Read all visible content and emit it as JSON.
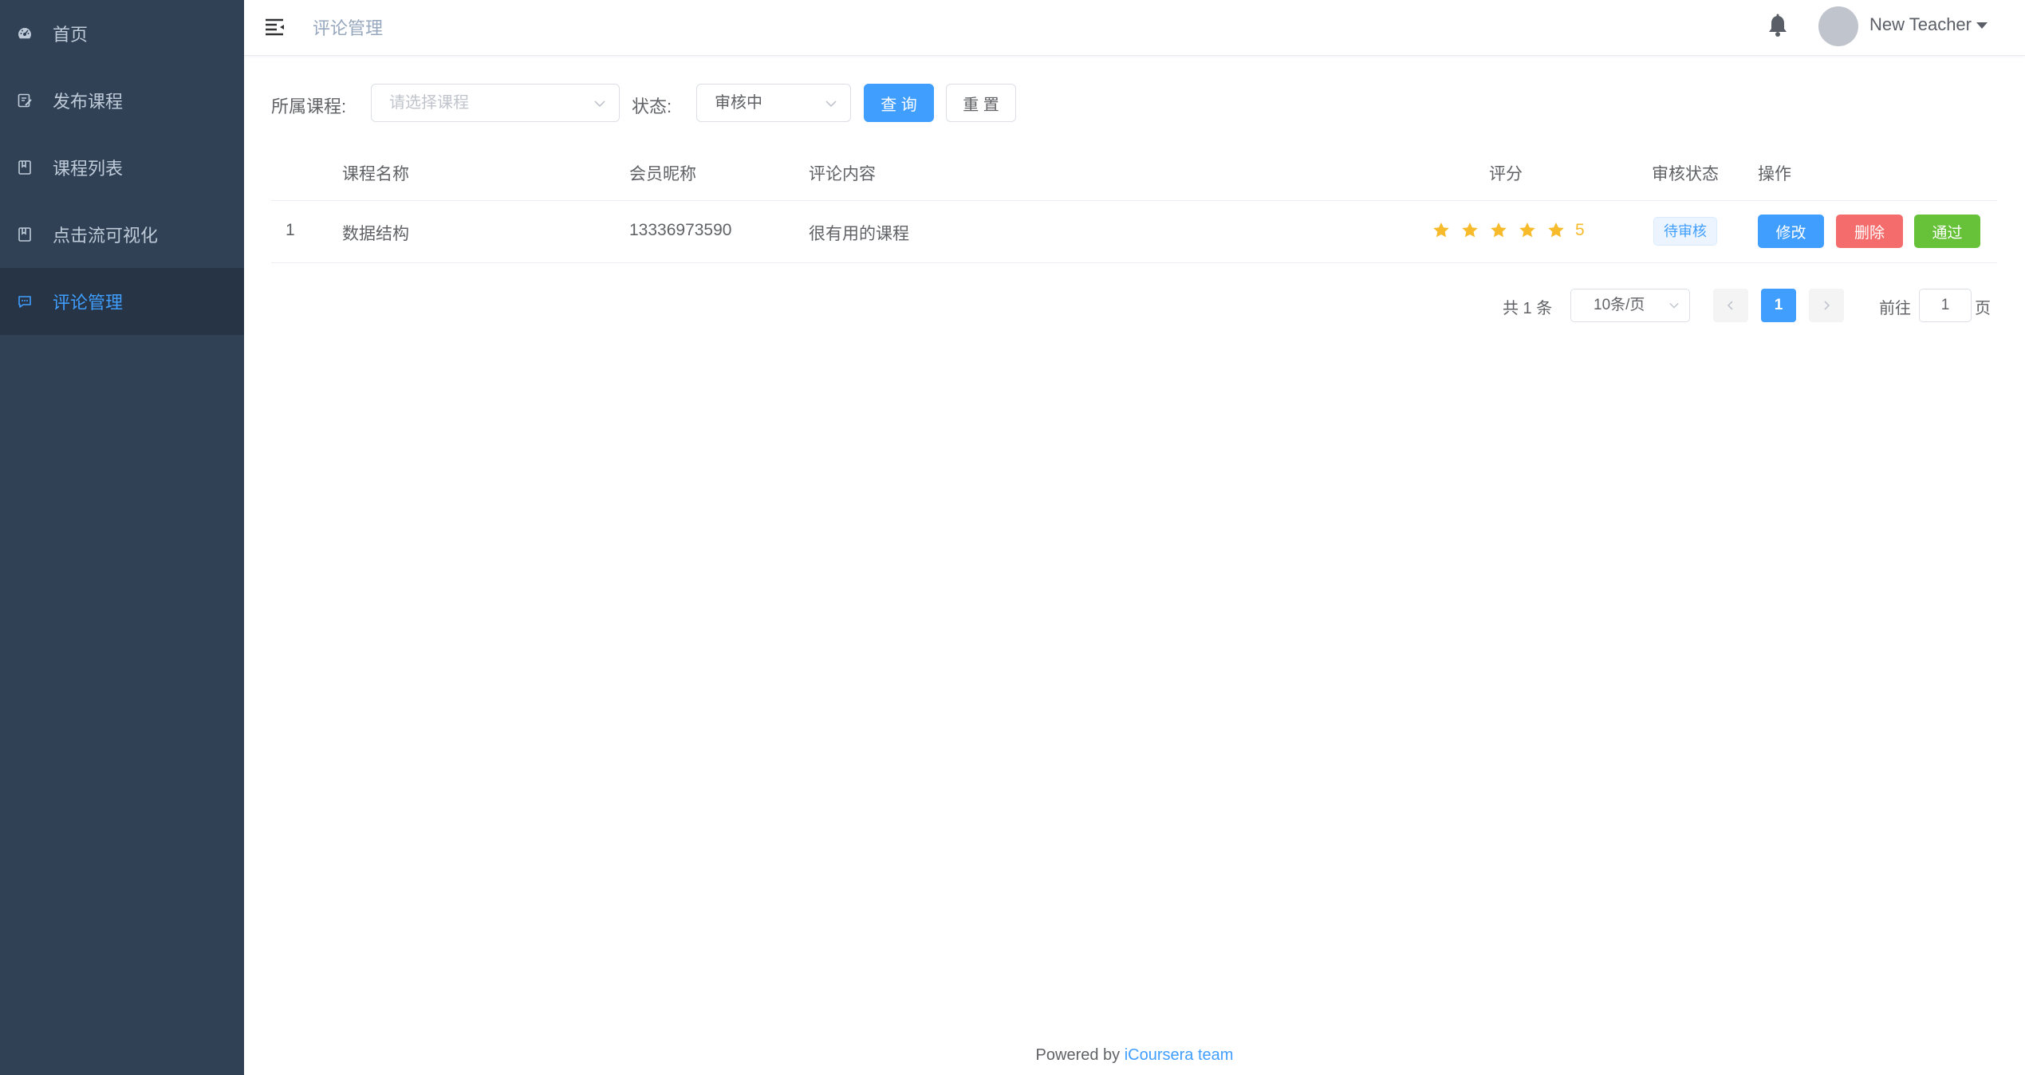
{
  "sidebar": {
    "items": [
      {
        "label": "首页",
        "icon": "dashboard-icon"
      },
      {
        "label": "发布课程",
        "icon": "edit-icon"
      },
      {
        "label": "课程列表",
        "icon": "book-icon"
      },
      {
        "label": "点击流可视化",
        "icon": "book-icon"
      },
      {
        "label": "评论管理",
        "icon": "chat-icon",
        "active": true
      }
    ]
  },
  "header": {
    "breadcrumb": "评论管理",
    "username": "New Teacher"
  },
  "filters": {
    "course_label": "所属课程:",
    "course_placeholder": "请选择课程",
    "status_label": "状态:",
    "status_value": "审核中",
    "query_button": "查 询",
    "reset_button": "重 置"
  },
  "table": {
    "columns": [
      "课程名称",
      "会员昵称",
      "评论内容",
      "评分",
      "审核状态",
      "操作"
    ],
    "rows": [
      {
        "index": "1",
        "course": "数据结构",
        "nickname": "13336973590",
        "content": "很有用的课程",
        "rating": 5,
        "rating_text": "5",
        "status": "待审核",
        "actions": {
          "edit": "修改",
          "delete": "删除",
          "pass": "通过"
        }
      }
    ]
  },
  "pagination": {
    "total": "共 1 条",
    "page_size": "10条/页",
    "current_page": "1",
    "goto_label": "前往",
    "goto_value": "1",
    "page_unit": "页"
  },
  "footer": {
    "prefix": "Powered by ",
    "link": "iCoursera team"
  },
  "colors": {
    "sidebar_bg": "#304156",
    "sidebar_active_bg": "#263445",
    "primary": "#409eff",
    "danger": "#f56c6c",
    "success": "#67c23a",
    "star": "#f7ba2a"
  }
}
